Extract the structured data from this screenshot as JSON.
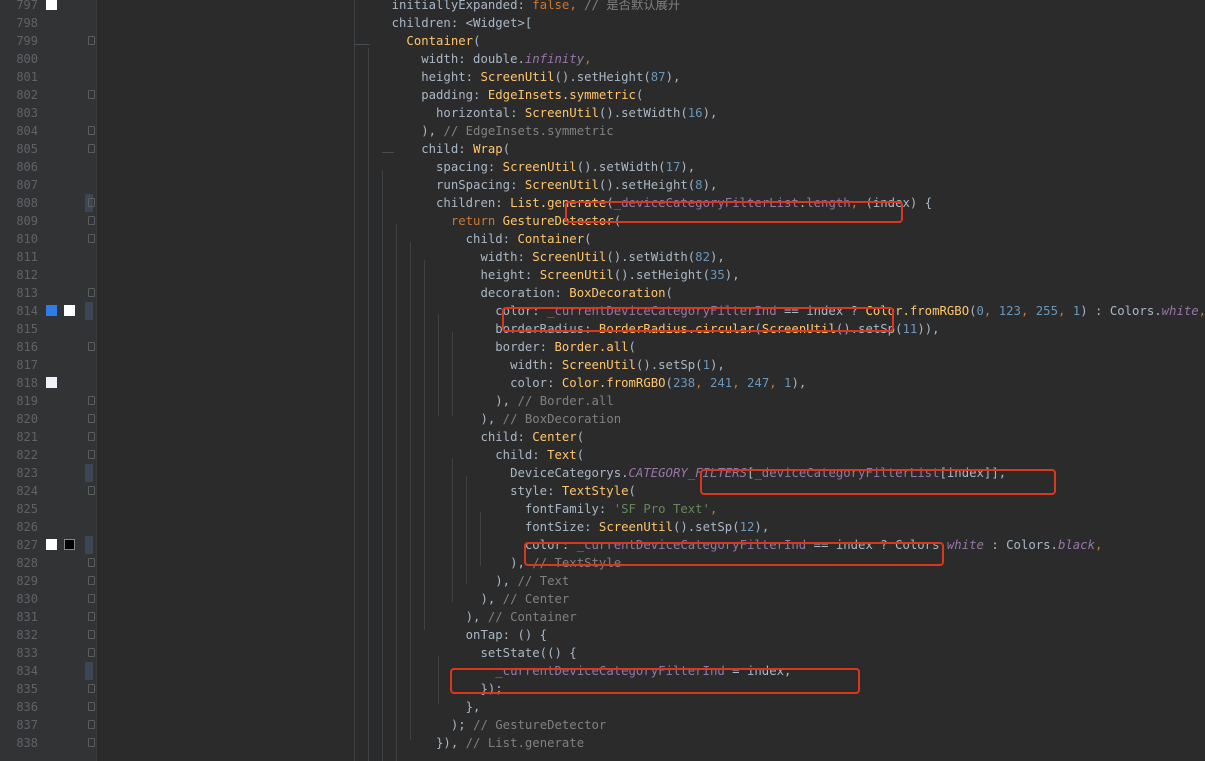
{
  "editor": {
    "language": "Dart",
    "theme_bg": "#2b2b2b"
  },
  "colors": {
    "highlight_box": "#d9371e",
    "swatch_blue": "#007bff",
    "swatch_white": "#ffffff",
    "swatch_black": "#000000",
    "swatch_gray": "#eef1f7"
  },
  "lines": [
    {
      "num": "797",
      "indent": 0,
      "tokens": [
        {
          "t": "    ",
          "c": "prm"
        },
        {
          "t": "initiallyExpanded: ",
          "c": "prm"
        },
        {
          "t": "false",
          "c": "kw"
        },
        {
          "t": ", ",
          "c": "kw"
        },
        {
          "t": "// 是否默认展开",
          "c": "cmt"
        }
      ],
      "swatches": [
        {
          "color": "#ffffff",
          "border": "#ffffff"
        }
      ]
    },
    {
      "num": "798",
      "tokens": [
        {
          "t": "    children: <Widget>[",
          "c": "prm"
        }
      ]
    },
    {
      "num": "799",
      "tokens": [
        {
          "t": "      ",
          "c": "prm"
        },
        {
          "t": "Container",
          "c": "cls"
        },
        {
          "t": "(",
          "c": "prm"
        }
      ]
    },
    {
      "num": "800",
      "tokens": [
        {
          "t": "        width: double.",
          "c": "prm"
        },
        {
          "t": "infinity",
          "c": "italic"
        },
        {
          "t": ",",
          "c": "kw"
        }
      ]
    },
    {
      "num": "801",
      "tokens": [
        {
          "t": "        height: ",
          "c": "prm"
        },
        {
          "t": "ScreenUtil",
          "c": "cls"
        },
        {
          "t": "().setHeight(",
          "c": "prm"
        },
        {
          "t": "87",
          "c": "num"
        },
        {
          "t": "),",
          "c": "prm"
        }
      ]
    },
    {
      "num": "802",
      "tokens": [
        {
          "t": "        padding: ",
          "c": "prm"
        },
        {
          "t": "EdgeInsets.symmetric",
          "c": "cls"
        },
        {
          "t": "(",
          "c": "prm"
        }
      ]
    },
    {
      "num": "803",
      "tokens": [
        {
          "t": "          horizontal: ",
          "c": "prm"
        },
        {
          "t": "ScreenUtil",
          "c": "cls"
        },
        {
          "t": "().setWidth(",
          "c": "prm"
        },
        {
          "t": "16",
          "c": "num"
        },
        {
          "t": "),",
          "c": "prm"
        }
      ]
    },
    {
      "num": "804",
      "tokens": [
        {
          "t": "        ), ",
          "c": "prm"
        },
        {
          "t": "// EdgeInsets.symmetric",
          "c": "cmt"
        }
      ]
    },
    {
      "num": "805",
      "tokens": [
        {
          "t": "        child: ",
          "c": "prm"
        },
        {
          "t": "Wrap",
          "c": "cls"
        },
        {
          "t": "(",
          "c": "prm"
        }
      ]
    },
    {
      "num": "806",
      "tokens": [
        {
          "t": "          spacing: ",
          "c": "prm"
        },
        {
          "t": "ScreenUtil",
          "c": "cls"
        },
        {
          "t": "().setWidth(",
          "c": "prm"
        },
        {
          "t": "17",
          "c": "num"
        },
        {
          "t": "),",
          "c": "prm"
        }
      ]
    },
    {
      "num": "807",
      "tokens": [
        {
          "t": "          runSpacing: ",
          "c": "prm"
        },
        {
          "t": "ScreenUtil",
          "c": "cls"
        },
        {
          "t": "().setHeight(",
          "c": "prm"
        },
        {
          "t": "8",
          "c": "num"
        },
        {
          "t": "),",
          "c": "prm"
        }
      ]
    },
    {
      "num": "808",
      "tokens": [
        {
          "t": "          children: ",
          "c": "prm"
        },
        {
          "t": "List.generate",
          "c": "cls"
        },
        {
          "t": "(",
          "c": "prm"
        },
        {
          "t": "_deviceCategoryFilterList",
          "c": "prop"
        },
        {
          "t": ".",
          "c": "prm"
        },
        {
          "t": "length",
          "c": "prop"
        },
        {
          "t": ", ",
          "c": "kw"
        },
        {
          "t": "(index) {",
          "c": "prm"
        }
      ],
      "changed": true
    },
    {
      "num": "809",
      "tokens": [
        {
          "t": "            ",
          "c": "prm"
        },
        {
          "t": "return ",
          "c": "kw"
        },
        {
          "t": "GestureDetector",
          "c": "cls"
        },
        {
          "t": "(",
          "c": "prm"
        }
      ]
    },
    {
      "num": "810",
      "tokens": [
        {
          "t": "              child: ",
          "c": "prm"
        },
        {
          "t": "Container",
          "c": "cls"
        },
        {
          "t": "(",
          "c": "prm"
        }
      ]
    },
    {
      "num": "811",
      "tokens": [
        {
          "t": "                width: ",
          "c": "prm"
        },
        {
          "t": "ScreenUtil",
          "c": "cls"
        },
        {
          "t": "().setWidth(",
          "c": "prm"
        },
        {
          "t": "82",
          "c": "num"
        },
        {
          "t": "),",
          "c": "prm"
        }
      ]
    },
    {
      "num": "812",
      "tokens": [
        {
          "t": "                height: ",
          "c": "prm"
        },
        {
          "t": "ScreenUtil",
          "c": "cls"
        },
        {
          "t": "().setHeight(",
          "c": "prm"
        },
        {
          "t": "35",
          "c": "num"
        },
        {
          "t": "),",
          "c": "prm"
        }
      ]
    },
    {
      "num": "813",
      "tokens": [
        {
          "t": "                decoration: ",
          "c": "prm"
        },
        {
          "t": "BoxDecoration",
          "c": "cls"
        },
        {
          "t": "(",
          "c": "prm"
        }
      ]
    },
    {
      "num": "814",
      "tokens": [
        {
          "t": "                  color: ",
          "c": "prm"
        },
        {
          "t": "_currentDeviceCategoryFilterInd",
          "c": "prop"
        },
        {
          "t": " == index ? ",
          "c": "prm"
        },
        {
          "t": "Color.fromRGBO",
          "c": "cls"
        },
        {
          "t": "(",
          "c": "prm"
        },
        {
          "t": "0",
          "c": "num"
        },
        {
          "t": ", ",
          "c": "kw"
        },
        {
          "t": "123",
          "c": "num"
        },
        {
          "t": ", ",
          "c": "kw"
        },
        {
          "t": "255",
          "c": "num"
        },
        {
          "t": ", ",
          "c": "kw"
        },
        {
          "t": "1",
          "c": "num"
        },
        {
          "t": ") : Colors.",
          "c": "prm"
        },
        {
          "t": "white",
          "c": "italic"
        },
        {
          "t": ",",
          "c": "kw"
        }
      ],
      "swatches": [
        {
          "color": "#2f7be8",
          "border": "#2f7be8"
        },
        {
          "color": "#ffffff",
          "border": "#ffffff"
        }
      ],
      "changed": true
    },
    {
      "num": "815",
      "tokens": [
        {
          "t": "                  borderRadius: ",
          "c": "prm"
        },
        {
          "t": "BorderRadius.circular",
          "c": "cls"
        },
        {
          "t": "(",
          "c": "prm"
        },
        {
          "t": "ScreenUtil",
          "c": "cls"
        },
        {
          "t": "().setSp(",
          "c": "prm"
        },
        {
          "t": "11",
          "c": "num"
        },
        {
          "t": ")),",
          "c": "prm"
        }
      ]
    },
    {
      "num": "816",
      "tokens": [
        {
          "t": "                  border: ",
          "c": "prm"
        },
        {
          "t": "Border.all",
          "c": "cls"
        },
        {
          "t": "(",
          "c": "prm"
        }
      ]
    },
    {
      "num": "817",
      "tokens": [
        {
          "t": "                    width: ",
          "c": "prm"
        },
        {
          "t": "ScreenUtil",
          "c": "cls"
        },
        {
          "t": "().setSp(",
          "c": "prm"
        },
        {
          "t": "1",
          "c": "num"
        },
        {
          "t": "),",
          "c": "prm"
        }
      ]
    },
    {
      "num": "818",
      "tokens": [
        {
          "t": "                    color: ",
          "c": "prm"
        },
        {
          "t": "Color.fromRGBO",
          "c": "cls"
        },
        {
          "t": "(",
          "c": "prm"
        },
        {
          "t": "238",
          "c": "num"
        },
        {
          "t": ", ",
          "c": "kw"
        },
        {
          "t": "241",
          "c": "num"
        },
        {
          "t": ", ",
          "c": "kw"
        },
        {
          "t": "247",
          "c": "num"
        },
        {
          "t": ", ",
          "c": "kw"
        },
        {
          "t": "1",
          "c": "num"
        },
        {
          "t": "),",
          "c": "prm"
        }
      ],
      "swatches": [
        {
          "color": "#eef1f7",
          "border": "#eef1f7"
        }
      ]
    },
    {
      "num": "819",
      "tokens": [
        {
          "t": "                  ), ",
          "c": "prm"
        },
        {
          "t": "// Border.all",
          "c": "cmt"
        }
      ]
    },
    {
      "num": "820",
      "tokens": [
        {
          "t": "                ), ",
          "c": "prm"
        },
        {
          "t": "// BoxDecoration",
          "c": "cmt"
        }
      ]
    },
    {
      "num": "821",
      "tokens": [
        {
          "t": "                child: ",
          "c": "prm"
        },
        {
          "t": "Center",
          "c": "cls"
        },
        {
          "t": "(",
          "c": "prm"
        }
      ]
    },
    {
      "num": "822",
      "tokens": [
        {
          "t": "                  child: ",
          "c": "prm"
        },
        {
          "t": "Text",
          "c": "cls"
        },
        {
          "t": "(",
          "c": "prm"
        }
      ]
    },
    {
      "num": "823",
      "tokens": [
        {
          "t": "                    DeviceCategorys.",
          "c": "prm"
        },
        {
          "t": "CATEGORY_FILTERS",
          "c": "italic"
        },
        {
          "t": "[",
          "c": "prm"
        },
        {
          "t": "_deviceCategoryFilterList",
          "c": "prop"
        },
        {
          "t": "[index]],",
          "c": "prm"
        }
      ],
      "changed": true
    },
    {
      "num": "824",
      "tokens": [
        {
          "t": "                    style: ",
          "c": "prm"
        },
        {
          "t": "TextStyle",
          "c": "cls"
        },
        {
          "t": "(",
          "c": "prm"
        }
      ]
    },
    {
      "num": "825",
      "tokens": [
        {
          "t": "                      fontFamily: ",
          "c": "prm"
        },
        {
          "t": "'SF Pro Text'",
          "c": "str"
        },
        {
          "t": ",",
          "c": "kw"
        }
      ]
    },
    {
      "num": "826",
      "tokens": [
        {
          "t": "                      fontSize: ",
          "c": "prm"
        },
        {
          "t": "ScreenUtil",
          "c": "cls"
        },
        {
          "t": "().setSp(",
          "c": "prm"
        },
        {
          "t": "12",
          "c": "num"
        },
        {
          "t": "),",
          "c": "prm"
        }
      ]
    },
    {
      "num": "827",
      "tokens": [
        {
          "t": "                      color: ",
          "c": "prm"
        },
        {
          "t": "_currentDeviceCategoryFilterInd",
          "c": "prop"
        },
        {
          "t": " == index ? Colors.",
          "c": "prm"
        },
        {
          "t": "white",
          "c": "italic"
        },
        {
          "t": " : Colors.",
          "c": "prm"
        },
        {
          "t": "black",
          "c": "italic"
        },
        {
          "t": ",",
          "c": "kw"
        }
      ],
      "swatches": [
        {
          "color": "#ffffff",
          "border": "#ffffff"
        },
        {
          "color": "#000000",
          "border": "#888888"
        }
      ],
      "changed": true
    },
    {
      "num": "828",
      "tokens": [
        {
          "t": "                    ), ",
          "c": "prm"
        },
        {
          "t": "// TextStyle",
          "c": "cmt"
        }
      ]
    },
    {
      "num": "829",
      "tokens": [
        {
          "t": "                  ), ",
          "c": "prm"
        },
        {
          "t": "// Text",
          "c": "cmt"
        }
      ]
    },
    {
      "num": "830",
      "tokens": [
        {
          "t": "                ), ",
          "c": "prm"
        },
        {
          "t": "// Center",
          "c": "cmt"
        }
      ]
    },
    {
      "num": "831",
      "tokens": [
        {
          "t": "              ), ",
          "c": "prm"
        },
        {
          "t": "// Container",
          "c": "cmt"
        }
      ]
    },
    {
      "num": "832",
      "tokens": [
        {
          "t": "              onTap: () {",
          "c": "prm"
        }
      ]
    },
    {
      "num": "833",
      "tokens": [
        {
          "t": "                setState(() {",
          "c": "prm"
        }
      ]
    },
    {
      "num": "834",
      "tokens": [
        {
          "t": "                  ",
          "c": "prm"
        },
        {
          "t": "_currentDeviceCategoryFilterInd",
          "c": "prop"
        },
        {
          "t": " = index;",
          "c": "prm"
        }
      ],
      "changed": true
    },
    {
      "num": "835",
      "tokens": [
        {
          "t": "                });",
          "c": "prm"
        }
      ]
    },
    {
      "num": "836",
      "tokens": [
        {
          "t": "              },",
          "c": "prm"
        }
      ]
    },
    {
      "num": "837",
      "tokens": [
        {
          "t": "            ); ",
          "c": "prm"
        },
        {
          "t": "// GestureDetector",
          "c": "cmt"
        }
      ]
    },
    {
      "num": "838",
      "tokens": [
        {
          "t": "          }), ",
          "c": "prm"
        },
        {
          "t": "// List.generate",
          "c": "cmt"
        }
      ]
    }
  ]
}
